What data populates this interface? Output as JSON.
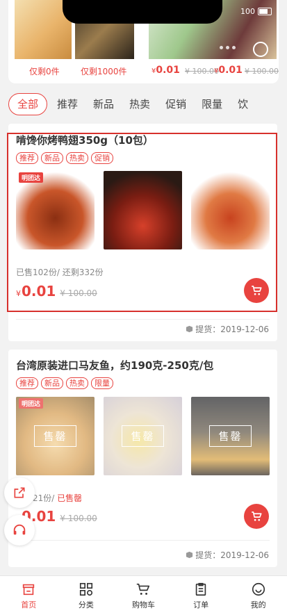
{
  "status": {
    "signal": "100"
  },
  "top_strip": {
    "items": [
      {
        "remain": "仅剩0件"
      },
      {
        "remain": "仅剩1000件"
      }
    ],
    "prices": [
      {
        "symbol": "¥",
        "price": "0.01",
        "old": "¥ 100.00"
      },
      {
        "symbol": "¥",
        "price": "0.01",
        "old": "¥ 100.00"
      }
    ]
  },
  "tabs": [
    "全部",
    "推荐",
    "新品",
    "热卖",
    "促销",
    "限量",
    "饮"
  ],
  "products": [
    {
      "title": "啃馋你烤鸭翅350g（10包）",
      "tags": [
        "推荐",
        "新品",
        "热卖",
        "促销"
      ],
      "image_badge": "明团达",
      "sold": "已售102份/ 还剩332份",
      "currency": "¥",
      "price": "0.01",
      "old_price": "¥ 100.00",
      "pickup": "提货：2019-12-06"
    },
    {
      "title": "台湾原装进口马友鱼，约190克-250克/包",
      "tags": [
        "推荐",
        "新品",
        "热卖",
        "限量"
      ],
      "image_badge": "明团达",
      "soldout_label": "售罄",
      "sold_prefix": "已售21份/ ",
      "sold_hot": "已售罄",
      "currency": "¥",
      "price": "0.01",
      "old_price": "¥ 100.00",
      "pickup": "提货：2019-12-06"
    }
  ],
  "nav": [
    {
      "label": "首页",
      "icon": "home-icon"
    },
    {
      "label": "分类",
      "icon": "grid-icon"
    },
    {
      "label": "购物车",
      "icon": "cart-icon"
    },
    {
      "label": "订单",
      "icon": "order-icon"
    },
    {
      "label": "我的",
      "icon": "smile-icon"
    }
  ],
  "colors": {
    "accent": "#e8433f"
  }
}
